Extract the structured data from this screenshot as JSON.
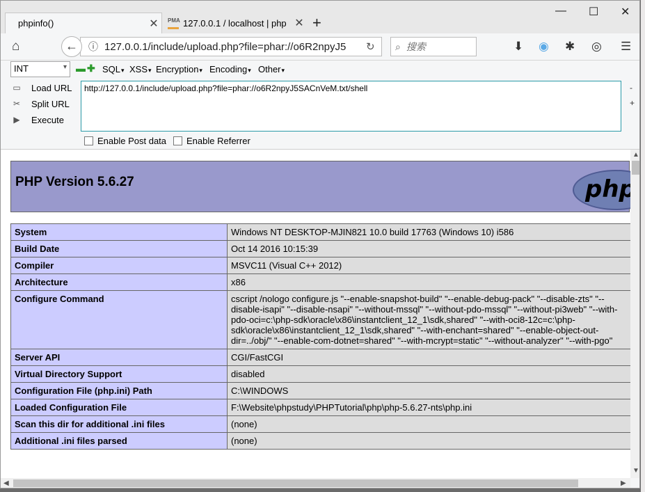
{
  "tabs": [
    {
      "label": "phpinfo()",
      "active": true
    },
    {
      "label": "127.0.0.1 / localhost | php",
      "icon_text": "PMA",
      "active": false
    }
  ],
  "window_controls": {
    "minimize": "—",
    "maximize": "☐",
    "close": "✕"
  },
  "nav": {
    "url": "127.0.0.1/include/upload.php?file=phar://o6R2npyJ5",
    "search_placeholder": "搜索"
  },
  "hackbar": {
    "select_value": "INT",
    "menus": [
      "SQL",
      "XSS",
      "Encryption",
      "Encoding",
      "Other"
    ],
    "load_url": "Load URL",
    "split_url": "Split URL",
    "execute": "Execute",
    "url_text": "http://127.0.0.1/include/upload.php?file=phar://o6R2npyJ5SACnVeM.txt/shell",
    "enable_post": "Enable Post data",
    "enable_referrer": "Enable Referrer"
  },
  "php": {
    "version_title": "PHP Version 5.6.27",
    "logo_text": "php",
    "rows": [
      {
        "key": "System",
        "value": "Windows NT DESKTOP-MJIN821 10.0 build 17763 (Windows 10) i586"
      },
      {
        "key": "Build Date",
        "value": "Oct 14 2016 10:15:39"
      },
      {
        "key": "Compiler",
        "value": "MSVC11 (Visual C++ 2012)"
      },
      {
        "key": "Architecture",
        "value": "x86"
      },
      {
        "key": "Configure Command",
        "value": "cscript /nologo configure.js \"--enable-snapshot-build\" \"--enable-debug-pack\" \"--disable-zts\" \"--disable-isapi\" \"--disable-nsapi\" \"--without-mssql\" \"--without-pdo-mssql\" \"--without-pi3web\" \"--with-pdo-oci=c:\\php-sdk\\oracle\\x86\\instantclient_12_1\\sdk,shared\" \"--with-oci8-12c=c:\\php-sdk\\oracle\\x86\\instantclient_12_1\\sdk,shared\" \"--with-enchant=shared\" \"--enable-object-out-dir=../obj/\" \"--enable-com-dotnet=shared\" \"--with-mcrypt=static\" \"--without-analyzer\" \"--with-pgo\""
      },
      {
        "key": "Server API",
        "value": "CGI/FastCGI"
      },
      {
        "key": "Virtual Directory Support",
        "value": "disabled"
      },
      {
        "key": "Configuration File (php.ini) Path",
        "value": "C:\\WINDOWS"
      },
      {
        "key": "Loaded Configuration File",
        "value": "F:\\Website\\phpstudy\\PHPTutorial\\php\\php-5.6.27-nts\\php.ini"
      },
      {
        "key": "Scan this dir for additional .ini files",
        "value": "(none)"
      },
      {
        "key": "Additional .ini files parsed",
        "value": "(none)"
      }
    ]
  }
}
